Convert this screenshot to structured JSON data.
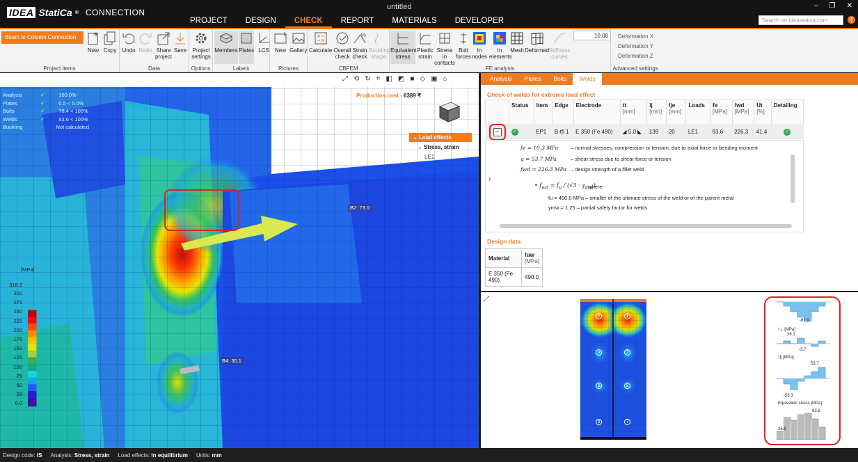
{
  "window": {
    "title": "untitled"
  },
  "app": {
    "logo_idea": "IDEA",
    "logo_statica": "StatiCa",
    "logo_reg": "®",
    "product": "CONNECTION"
  },
  "menu": [
    "PROJECT",
    "DESIGN",
    "CHECK",
    "REPORT",
    "MATERIALS",
    "DEVELOPER"
  ],
  "menu_active": "CHECK",
  "search": {
    "placeholder": "Search on ideastatica.com"
  },
  "ribbon": {
    "project_combo": "Beam to Column Connection",
    "groups": {
      "project_items": "Project items",
      "data": "Data",
      "options": "Options",
      "labels": "Labels",
      "pictures": "Pictures",
      "cbfem": "CBFEM",
      "fe_analysis": "FE analysis",
      "advanced": "Advanced settings"
    },
    "buttons": {
      "new": "New",
      "copy": "Copy",
      "undo": "Undo",
      "redo": "Redo",
      "share": "Share project",
      "save": "Save",
      "project_settings": "Project settings",
      "members": "Members",
      "plates": "Plates",
      "lcs": "LCS",
      "pic_new": "New",
      "gallery": "Gallery",
      "calculate": "Calculate",
      "overall_check": "Overall check",
      "strain_check": "Strain check",
      "buckling": "Buckling shape",
      "equivalent_stress": "Equivalent stress",
      "plastic_strain": "Plastic strain",
      "stress_contacts": "Stress in contacts",
      "bolt_forces": "Bolt forces",
      "in_nodes": "In nodes",
      "in_elements": "In elements",
      "mesh": "Mesh",
      "deformed": "Deformed",
      "stiffness": "Stiffness curves"
    },
    "scale_value": "10.00",
    "deformations": [
      "Deformation X",
      "Deformation Y",
      "Deformation Z"
    ]
  },
  "viewport": {
    "production_cost_label": "Production cost",
    "production_cost_value": "6389 ₹",
    "legend": [
      {
        "label": "Analysis",
        "value": "100.0%"
      },
      {
        "label": "Plates",
        "value": "0.5 < 5.0%"
      },
      {
        "label": "Bolts",
        "value": "78.4 < 100%"
      },
      {
        "label": "Welds",
        "value": "93.6 < 100%"
      },
      {
        "label": "Buckling",
        "value": "Not calculated"
      }
    ],
    "load_tree": {
      "header": "Load effects",
      "sub": "Stress, strain",
      "leaf": "LE1"
    },
    "scale_unit": "[MPa]",
    "scale_max": "318.2",
    "scale_ticks": [
      "300",
      "275",
      "250",
      "225",
      "200",
      "175",
      "150",
      "125",
      "100",
      "75",
      "50",
      "25",
      "0.0"
    ],
    "annotations": {
      "b2": "B2: 73.0",
      "b4": "B4: 30.1"
    }
  },
  "rtabs": [
    "Analysis",
    "Plates",
    "Bolts",
    "Welds"
  ],
  "rtab_active": "Welds",
  "weld_check": {
    "title": "Check of welds for extreme load effect",
    "columns": [
      {
        "name": "Status",
        "unit": ""
      },
      {
        "name": "Item",
        "unit": ""
      },
      {
        "name": "Edge",
        "unit": ""
      },
      {
        "name": "Electrode",
        "unit": ""
      },
      {
        "name": "tt",
        "unit": "[mm]"
      },
      {
        "name": "lj",
        "unit": "[mm]"
      },
      {
        "name": "lje",
        "unit": "[mm]"
      },
      {
        "name": "Loads",
        "unit": ""
      },
      {
        "name": "fe",
        "unit": "[MPa]"
      },
      {
        "name": "fwd",
        "unit": "[MPa]"
      },
      {
        "name": "Ut",
        "unit": "[%]"
      },
      {
        "name": "Detailing",
        "unit": ""
      }
    ],
    "row": {
      "item": "EP1",
      "edge": "B-tfl 1",
      "electrode": "E 350 (Fe 490)",
      "tt": "5.0",
      "lj": "139",
      "lje": "20",
      "loads": "LE1",
      "fe": "93.6",
      "fwd": "226.3",
      "ut": "41.4"
    },
    "formulas": [
      {
        "sym": "fe = 10.3 MPa",
        "desc": "– normal stresses, compression or tension, due to axial force or bending moment"
      },
      {
        "sym": "q = 53.7 MPa",
        "desc": "– shear stress due to shear force or tension"
      },
      {
        "sym": "fwd = 226.3 MPa",
        "desc": "– design strength of a fillet weld"
      }
    ],
    "where": ", where:",
    "bullets": [
      "fu = 490.0 MPa – smaller of the ultimate stress of the weld or of the parent metal",
      "γmw = 1.25 – partial safety factor for welds"
    ]
  },
  "design_data": {
    "title": "Design data",
    "col_material": "Material",
    "col_fuw": "fuw",
    "col_fuw_unit": "[MPa]",
    "material": "E 350 (Fe 490)",
    "fuw": "490.0"
  },
  "stress_plots": {
    "plot1_label": "τ⊥ [MPa]",
    "plot1_min": "-67.9",
    "plot2_label": "τ∥ [MPa]",
    "plot2_max": "26.1",
    "plot2_min": "-3.7",
    "plot3_label": "Equivalent stress [MPa]",
    "plot3_max": "53.7",
    "plot3_min": "-53.3",
    "plot4_max": "93.6",
    "plot4_min": "26.9"
  },
  "weld_nodes": [
    "2",
    "1",
    "4",
    "3",
    "6",
    "5",
    "8",
    "7"
  ],
  "status_bar": {
    "design_code_label": "Design code:",
    "design_code": "IS",
    "analysis_label": "Analysis:",
    "analysis": "Stress, strain",
    "load_label": "Load effects:",
    "load": "In equilibrium",
    "units_label": "Units:",
    "units": "mm"
  }
}
